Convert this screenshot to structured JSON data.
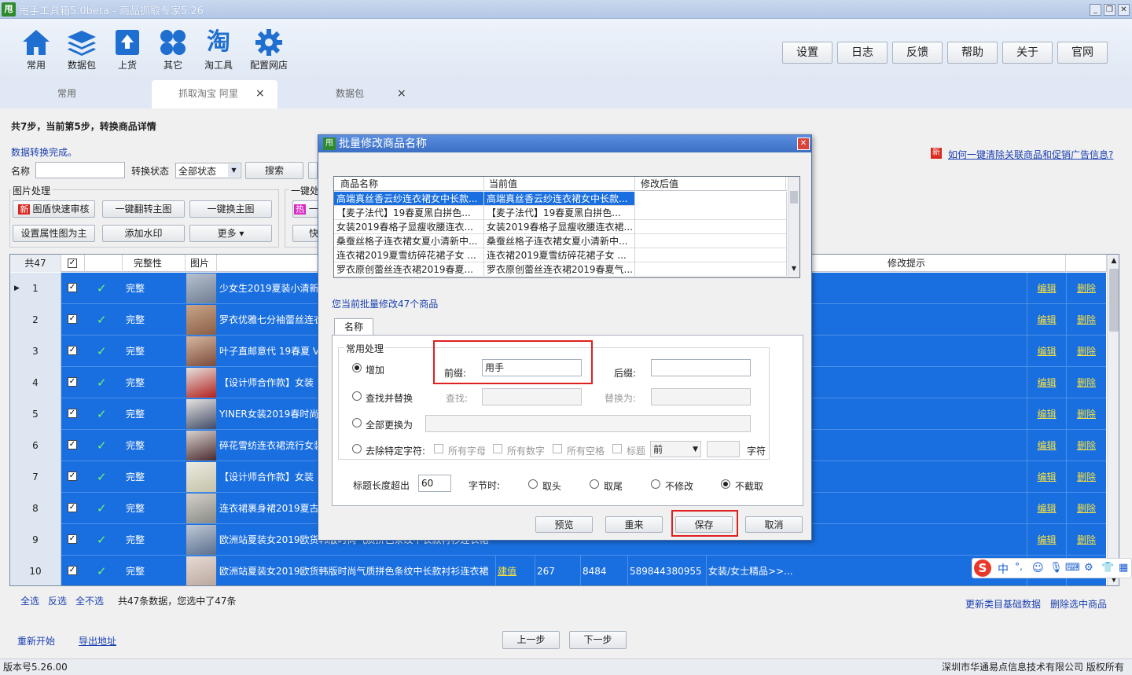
{
  "window": {
    "title": "甩手工具箱5.0beta - 商品抓取专家5.26",
    "icon_text": "甩"
  },
  "toolbar": {
    "tools": [
      {
        "label": "常用",
        "icon": "home-icon"
      },
      {
        "label": "数据包",
        "icon": "layers-icon"
      },
      {
        "label": "上货",
        "icon": "upload-icon"
      },
      {
        "label": "其它",
        "icon": "grid-icon"
      },
      {
        "label": "淘工具",
        "icon": "tao-icon"
      },
      {
        "label": "配置网店",
        "icon": "gear-icon"
      }
    ],
    "tao_glyph": "淘",
    "right_buttons": [
      "设置",
      "日志",
      "反馈",
      "帮助",
      "关于",
      "官网"
    ]
  },
  "tabs": [
    {
      "label": "常用",
      "closable": false
    },
    {
      "label": "抓取淘宝 阿里",
      "closable": true
    },
    {
      "label": "数据包",
      "closable": true
    }
  ],
  "tab_close": "×",
  "step": {
    "text": "共7步，当前第5步，转换商品详情"
  },
  "panel": {
    "status_text": "数据转换完成。",
    "name_label": "名称",
    "convert_status_label": "转换状态",
    "convert_status_value": "全部状态",
    "search_button": "搜索",
    "image_group": "图片处理",
    "new_badge": "新",
    "hot_badge": "热",
    "image_buttons": [
      "图盾快速审核",
      "一键翻转主图",
      "一键换主图",
      "设置属性图为主",
      "添加水印",
      "更多 ▾"
    ],
    "one_key_group": "一键处",
    "one_key_btn1": "一",
    "one_key_btn2": "快",
    "help_link": "如何一键清除关联商品和促销广告信息?"
  },
  "grid": {
    "headers": {
      "count": "共47",
      "complete": "完整性",
      "image": "图片",
      "hint": "修改提示"
    },
    "edit_label": "编辑",
    "delete_label": "删除",
    "status_value": "完整",
    "check_mark": "✓",
    "box_mark": "✓",
    "row_pointer": "▶",
    "rows": [
      {
        "num": "1",
        "title": "少女生2019夏装小清新"
      },
      {
        "num": "2",
        "title": "罗衣优雅七分袖蕾丝连衣"
      },
      {
        "num": "3",
        "title": "叶子直邮意代 19春夏 V"
      },
      {
        "num": "4",
        "title": "【设计师合作款】女装"
      },
      {
        "num": "5",
        "title": "YINER女装2019春时尚"
      },
      {
        "num": "6",
        "title": "碎花雪纺连衣裙流行女装"
      },
      {
        "num": "7",
        "title": "【设计师合作款】女装"
      },
      {
        "num": "8",
        "title": "连衣裙裹身裙2019夏古"
      },
      {
        "num": "9",
        "title": "欧洲站夏装女2019欧货韩版时尚气质拼色条纹中长款衬衫连衣裙"
      },
      {
        "num": "10",
        "title": "欧洲站夏装女2019欧货韩版时尚气质拼色条纹中长款衬衫连衣裙",
        "link": "建值",
        "qty": "267",
        "sales": "8484",
        "id": "589844380955",
        "cat": "女装/女士精品>>..."
      }
    ]
  },
  "bottom": {
    "select_all": "全选",
    "invert": "反选",
    "select_none": "全不选",
    "summary": "共47条数据，您选中了47条",
    "update_link": "更新类目基础数据",
    "delete_selected": "删除选中商品",
    "restart": "重新开始",
    "export": "导出地址",
    "prev": "上一步",
    "next": "下一步"
  },
  "status": {
    "version": "版本号5.26.00",
    "copyright": "深圳市华通易点信息技术有限公司 版权所有"
  },
  "modal": {
    "title": "批量修改商品名称",
    "close": "✕",
    "columns": [
      "商品名称",
      "当前值",
      "修改后值"
    ],
    "rows": [
      {
        "name": "高端真丝香云纱连衣裙女中长款...",
        "current": "高端真丝香云纱连衣裙女中长款...",
        "after": ""
      },
      {
        "name": "【麦子法代】19春夏黑白拼色...",
        "current": "【麦子法代】19春夏黑白拼色...",
        "after": ""
      },
      {
        "name": "女装2019春格子显瘦收腰连衣...",
        "current": "女装2019春格子显瘦收腰连衣裙...",
        "after": ""
      },
      {
        "name": "桑蚕丝格子连衣裙女夏小清新中...",
        "current": "桑蚕丝格子连衣裙女夏小清新中...",
        "after": ""
      },
      {
        "name": "连衣裙2019夏雪纺碎花裙子女 ...",
        "current": "连衣裙2019夏雪纺碎花裙子女 ...",
        "after": ""
      },
      {
        "name": "罗衣原创蕾丝连衣裙2019春夏...",
        "current": "罗衣原创蕾丝连衣裙2019春夏气...",
        "after": ""
      }
    ],
    "notice": "您当前批量修改47个商品",
    "tab": "名称",
    "group": "常用处理",
    "opt_add": "增加",
    "prefix_label": "前缀:",
    "prefix_value": "用手",
    "suffix_label": "后缀:",
    "suffix_value": "",
    "opt_replace": "查找并替换",
    "find_label": "查找:",
    "replace_label": "替换为:",
    "opt_replace_all": "全部更换为",
    "opt_remove": "去除特定字符:",
    "chk_letters": "所有字母",
    "chk_digits": "所有数字",
    "chk_spaces": "所有空格",
    "chk_title": "标题",
    "title_pos": "前",
    "chars_label": "字符",
    "len_label": "标题长度超出",
    "len_value": "60",
    "bytes_label": "字节时:",
    "cut_head": "取头",
    "cut_tail": "取尾",
    "no_change": "不修改",
    "no_cut": "不截取",
    "btn_preview": "预览",
    "btn_reset": "重来",
    "btn_save": "保存",
    "btn_cancel": "取消"
  },
  "ime": {
    "logo": "S",
    "lang": "中",
    "punct": "°,"
  }
}
